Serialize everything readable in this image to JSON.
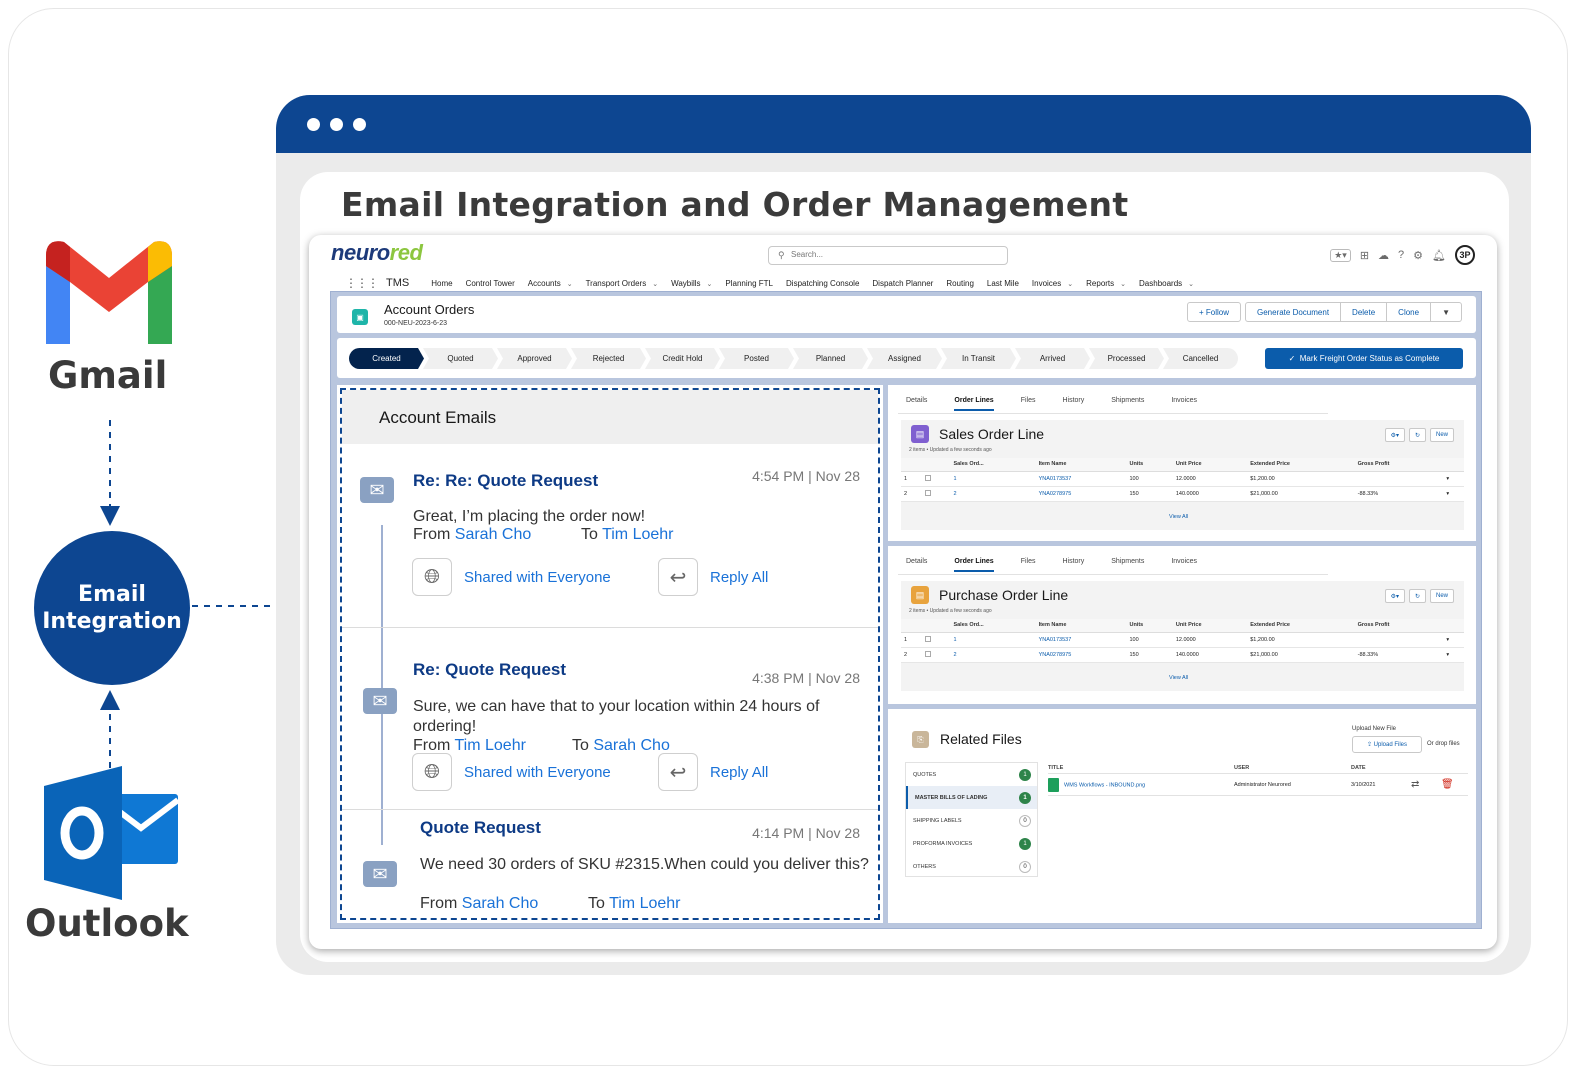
{
  "left": {
    "gmail_label": "Gmail",
    "integration_label_line1": "Email",
    "integration_label_line2": "Integration",
    "outlook_label": "Outlook"
  },
  "title": "Email Integration and Order Management",
  "app": {
    "brand_n": "n",
    "brand_mid": "euro",
    "brand_red": "red",
    "search_placeholder": "Search...",
    "avatar": "3P",
    "nav": {
      "app_name": "TMS",
      "items": [
        {
          "label": "Home",
          "chevron": false
        },
        {
          "label": "Control Tower",
          "chevron": false
        },
        {
          "label": "Accounts",
          "chevron": true
        },
        {
          "label": "Transport Orders",
          "chevron": true
        },
        {
          "label": "Waybills",
          "chevron": true
        },
        {
          "label": "Planning FTL",
          "chevron": false
        },
        {
          "label": "Dispatching Console",
          "chevron": false
        },
        {
          "label": "Dispatch Planner",
          "chevron": false
        },
        {
          "label": "Routing",
          "chevron": false
        },
        {
          "label": "Last Mile",
          "chevron": false
        },
        {
          "label": "Invoices",
          "chevron": true
        },
        {
          "label": "Reports",
          "chevron": true
        },
        {
          "label": "Dashboards",
          "chevron": true
        }
      ]
    },
    "record": {
      "title": "Account Orders",
      "subtitle": "000-NEU-2023-6-23",
      "follow": "+ Follow",
      "actions": [
        "Generate Document",
        "Delete",
        "Clone",
        "▼"
      ]
    },
    "stages": [
      "Created",
      "Quoted",
      "Approved",
      "Rejected",
      "Credit Hold",
      "Posted",
      "Planned",
      "Assigned",
      "In Transit",
      "Arrived",
      "Processed",
      "Cancelled"
    ],
    "active_stage": "Created",
    "mark_complete": "Mark Freight Order Status as Complete",
    "emails": {
      "heading": "Account Emails",
      "items": [
        {
          "subject": "Re: Re: Quote Request",
          "time": "4:54 PM | Nov 28",
          "body": "Great, I’m placing the order now!",
          "from_label": "From",
          "from": "Sarah Cho",
          "to_label": "To",
          "to": "Tim Loehr",
          "shared": "Shared with Everyone",
          "reply": "Reply All"
        },
        {
          "subject": "Re: Quote Request",
          "time": "4:38 PM | Nov 28",
          "body": "Sure, we can have that to your location within 24 hours of ordering!",
          "from_label": "From",
          "from": "Tim Loehr",
          "to_label": "To",
          "to": "Sarah Cho",
          "shared": "Shared with Everyone",
          "reply": "Reply All"
        },
        {
          "subject": "Quote Request",
          "time": "4:14 PM | Nov 28",
          "body": "We need 30 orders of SKU #2315.When could you deliver this?",
          "from_label": "From",
          "from": "Sarah Cho",
          "to_label": "To",
          "to": "Tim Loehr"
        }
      ]
    },
    "tabs": [
      "Details",
      "Order Lines",
      "Files",
      "History",
      "Shipments",
      "Invoices"
    ],
    "active_tab": "Order Lines",
    "sales": {
      "title": "Sales Order Line",
      "sub": "2 items • Updated a few seconds ago",
      "new": "New",
      "columns": [
        "",
        "",
        "Sales Ord...",
        "Item Name",
        "Units",
        "Unit Price",
        "Extended Price",
        "Gross Profit",
        ""
      ],
      "rows": [
        [
          "1",
          "1",
          "YNA0173537",
          "100",
          "12.0000",
          "$1,200.00",
          ""
        ],
        [
          "2",
          "2",
          "YNA0278975",
          "150",
          "140.0000",
          "$21,000.00",
          "-88.33%"
        ]
      ],
      "view_all": "View All"
    },
    "purchase": {
      "title": "Purchase Order Line",
      "sub": "2 items • Updated a few seconds ago",
      "new": "New",
      "columns": [
        "",
        "",
        "Sales Ord...",
        "Item Name",
        "Units",
        "Unit Price",
        "Extended Price",
        "Gross Profit",
        ""
      ],
      "rows": [
        [
          "1",
          "1",
          "YNA0173537",
          "100",
          "12.0000",
          "$1,200.00",
          ""
        ],
        [
          "2",
          "2",
          "YNA0278975",
          "150",
          "140.0000",
          "$21,000.00",
          "-88.33%"
        ]
      ],
      "view_all": "View All"
    },
    "files": {
      "title": "Related Files",
      "upload_label": "Upload New File",
      "upload_btn": "Upload Files",
      "drop": "Or drop files",
      "categories": [
        {
          "label": "QUOTES",
          "count": "1"
        },
        {
          "label": "MASTER BILLS OF LADING",
          "count": "1"
        },
        {
          "label": "SHIPPING LABELS",
          "count": "0"
        },
        {
          "label": "PROFORMA INVOICES",
          "count": "1"
        },
        {
          "label": "OTHERS",
          "count": "0"
        }
      ],
      "selected_category": "MASTER BILLS OF LADING",
      "headers": [
        "TITLE",
        "USER",
        "DATE"
      ],
      "row": {
        "title": "WMS Workflows - INBOUND.png",
        "user": "Administrator Neurored",
        "date": "3/10/2021"
      }
    }
  },
  "colors": {
    "navy": "#0d4691",
    "accent": "#0b5cab",
    "link": "#1a72d8",
    "success": "#2e844a"
  }
}
